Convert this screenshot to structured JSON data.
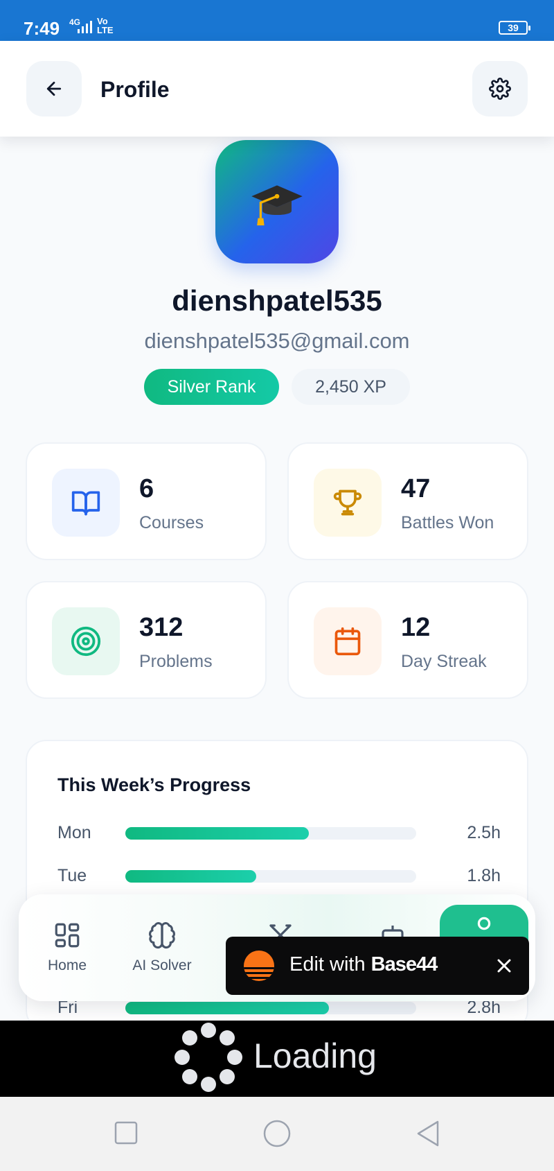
{
  "status_bar": {
    "time": "7:49",
    "signal": "4G",
    "lte": "Vo\nLTE",
    "battery": "39"
  },
  "header": {
    "title": "Profile",
    "back_icon": "arrow-left-icon",
    "settings_icon": "gear-icon"
  },
  "profile": {
    "avatar_emoji": "🎓",
    "username": "dienshpatel535",
    "email": "dienshpatel535@gmail.com",
    "rank": "Silver Rank",
    "xp": "2,450 XP"
  },
  "stats": [
    {
      "value": "6",
      "label": "Courses",
      "icon": "book-icon",
      "color": "#2563eb",
      "bg": "#eef4ff"
    },
    {
      "value": "47",
      "label": "Battles Won",
      "icon": "trophy-icon",
      "color": "#ca8a04",
      "bg": "#fef9e7"
    },
    {
      "value": "312",
      "label": "Problems",
      "icon": "target-icon",
      "color": "#10b981",
      "bg": "#e8f8f1"
    },
    {
      "value": "12",
      "label": "Day Streak",
      "icon": "calendar-icon",
      "color": "#ea580c",
      "bg": "#fff4ec"
    }
  ],
  "progress": {
    "title": "This Week’s Progress",
    "days": [
      {
        "day": "Mon",
        "hours": "2.5h",
        "fraction": 0.63
      },
      {
        "day": "Tue",
        "hours": "1.8h",
        "fraction": 0.45
      },
      {
        "day": "Fri",
        "hours": "2.8h",
        "fraction": 0.7
      }
    ]
  },
  "bottom_nav": {
    "items": [
      {
        "label": "Home",
        "icon": "grid-icon"
      },
      {
        "label": "AI Solver",
        "icon": "brain-icon"
      },
      {
        "label": "",
        "icon": "swords-icon"
      },
      {
        "label": "",
        "icon": "robot-icon"
      },
      {
        "label": "",
        "icon": "profile-icon",
        "active": true
      }
    ]
  },
  "base44_banner": {
    "edit_text": "Edit with",
    "brand": "Base44"
  },
  "loading": {
    "text": "Loading"
  },
  "android_nav": {
    "icons": [
      "recents-icon",
      "home-circle-icon",
      "back-triangle-icon"
    ]
  }
}
